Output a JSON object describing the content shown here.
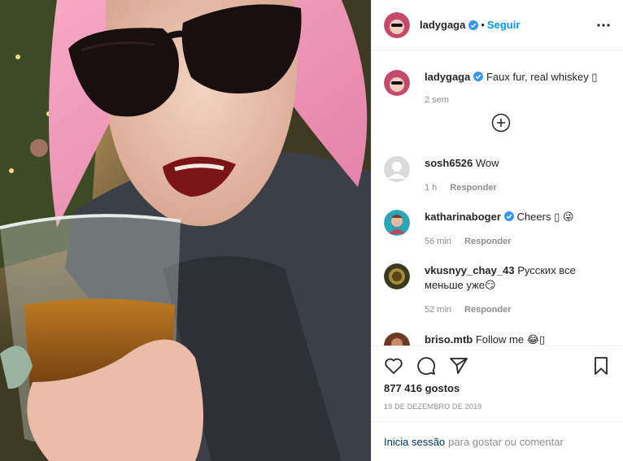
{
  "post": {
    "author": "ladygaga",
    "follow_label": "Seguir",
    "dot": "•",
    "caption_author": "ladygaga",
    "caption": "Faux fur, real whiskey ▯",
    "caption_time": "2 sem"
  },
  "comments": [
    {
      "user": "sosh6526",
      "text": "Wow",
      "time": "1 h",
      "reply": "Responder"
    },
    {
      "user": "katharinaboger",
      "text": "Cheers ▯ 😜",
      "time": "56 min",
      "reply": "Responder",
      "verified": true
    },
    {
      "user": "vkusnyy_chay_43",
      "text": "Русских все",
      "text2": "меньше уже😏",
      "time": "52 min",
      "reply": "Responder"
    },
    {
      "user": "briso.mtb",
      "text": "Follow me 😂▯"
    }
  ],
  "stats": {
    "likes": "877 416 gostos",
    "date": "19 DE DEZEMBRO DE 2019"
  },
  "login": {
    "link": "Inicia sessão",
    "rest": "para gostar ou comentar"
  },
  "colors": {
    "accent": "#0095f6",
    "verified": "#3897f0",
    "muted": "#8e8e8e"
  },
  "icons": [
    "more-icon",
    "verified-icon",
    "plus-circle-icon",
    "heart-icon",
    "comment-icon",
    "share-icon",
    "bookmark-icon"
  ]
}
